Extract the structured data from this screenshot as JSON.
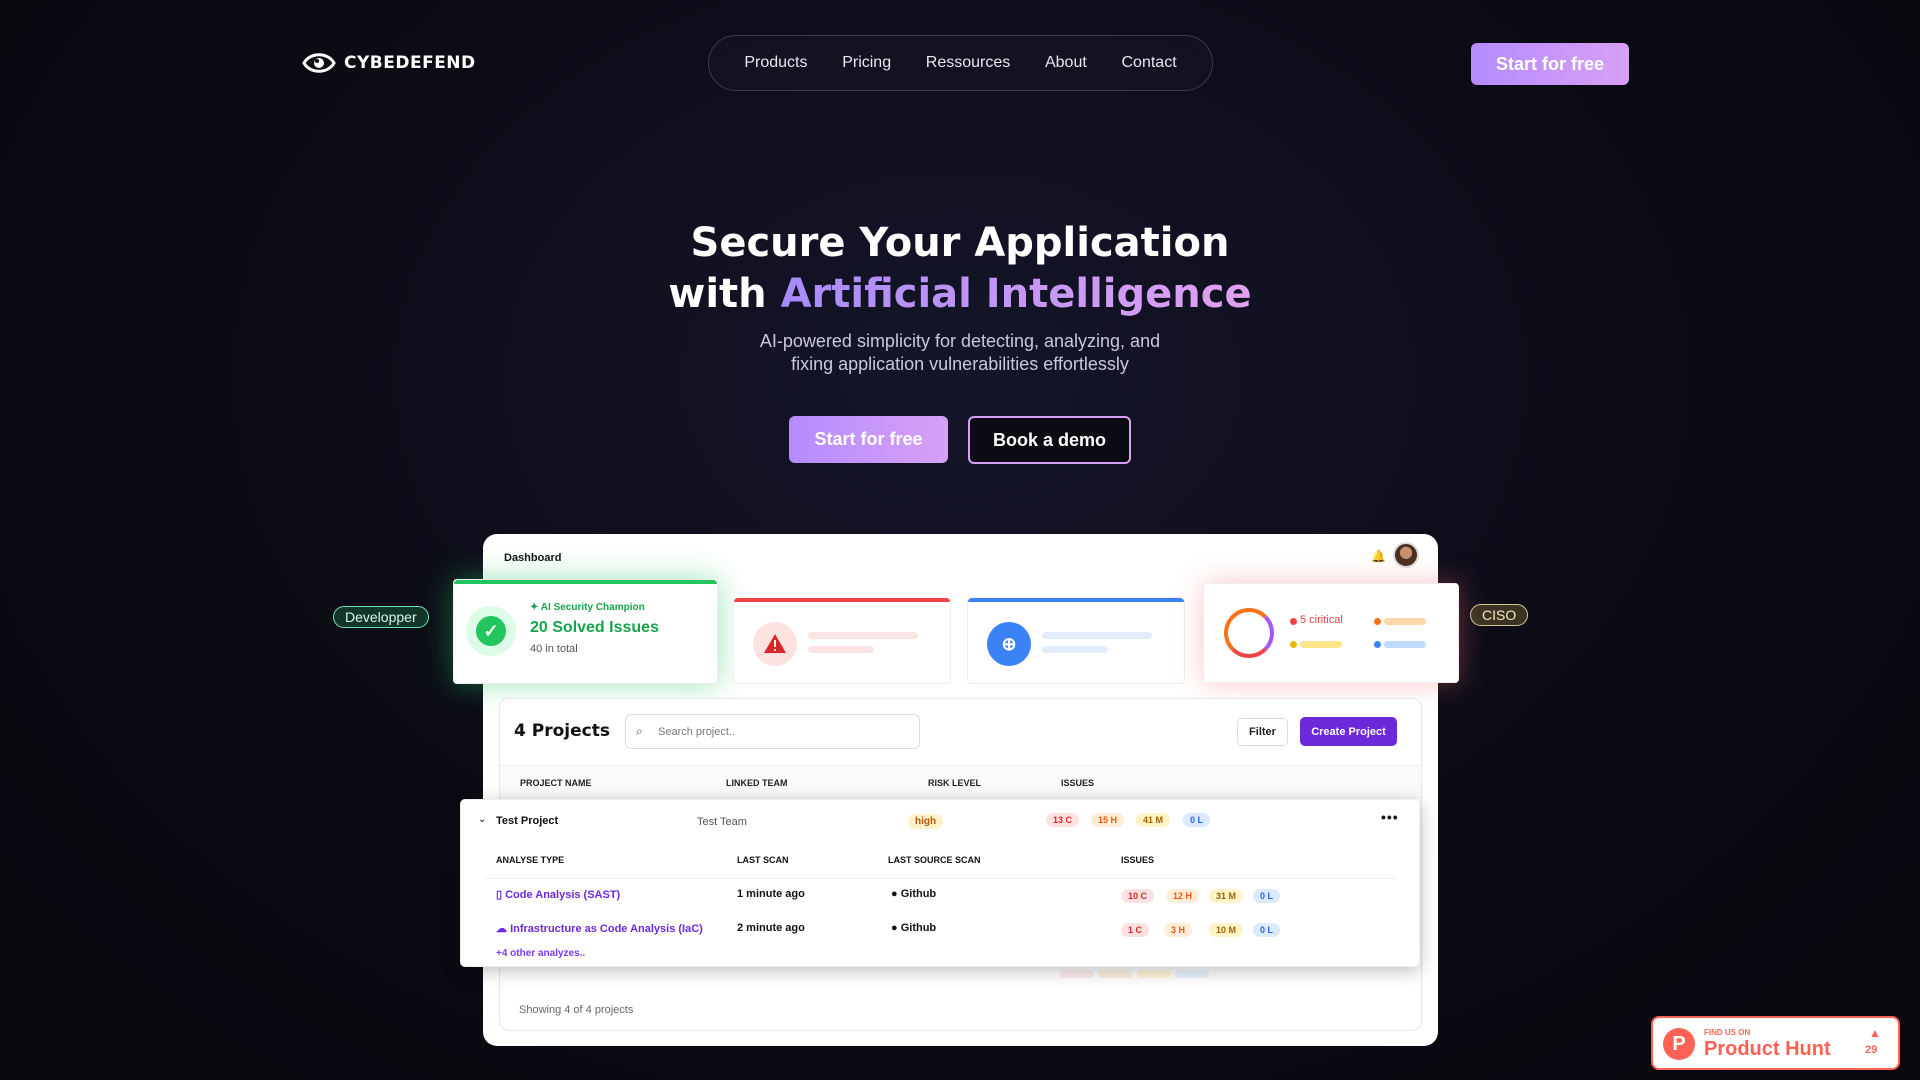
{
  "brand": {
    "name": "CYBEDEFEND"
  },
  "nav": {
    "items": [
      {
        "label": "Products"
      },
      {
        "label": "Pricing"
      },
      {
        "label": "Ressources"
      },
      {
        "label": "About"
      },
      {
        "label": "Contact"
      }
    ],
    "cta": "Start for free"
  },
  "hero": {
    "title_line1": "Secure Your Application",
    "title_line2_prefix": "with ",
    "title_line2_accent": "Artificial Intelligence",
    "subtitle_line1": "AI-powered simplicity for detecting, analyzing, and",
    "subtitle_line2": "fixing application vulnerabilities effortlessly",
    "cta_primary": "Start for free",
    "cta_secondary": "Book a demo"
  },
  "roles": {
    "dev": "Developper",
    "ciso": "CISO"
  },
  "dashboard": {
    "title": "Dashboard",
    "champion": {
      "tag": "AI Security Champion",
      "main": "20 Solved Issues",
      "sub": "40 in total"
    },
    "ciso_card": {
      "critical": "5 ciritical"
    },
    "projects": {
      "count_label": "4 Projects",
      "search_placeholder": "Search project..",
      "filter": "Filter",
      "create": "Create Project",
      "headers": [
        "PROJECT NAME",
        "LINKED TEAM",
        "RISK LEVEL",
        "ISSUES"
      ],
      "footer": "Showing 4 of 4 projects",
      "expanded": {
        "name": "Test Project",
        "team": "Test Team",
        "risk": "high",
        "issues": [
          "13 C",
          "15 H",
          "41 M",
          "0 L"
        ],
        "sub_headers": [
          "ANALYSE TYPE",
          "LAST SCAN",
          "LAST SOURCE SCAN",
          "ISSUES"
        ],
        "analyses": [
          {
            "name": "Code Analysis (SAST)",
            "last_scan": "1 minute ago",
            "source": "Github",
            "issues": [
              "10 C",
              "12 H",
              "31 M",
              "0 L"
            ]
          },
          {
            "name": "Infrastructure as Code Analysis (IaC)",
            "last_scan": "2 minute ago",
            "source": "Github",
            "issues": [
              "1 C",
              "3 H",
              "10 M",
              "0 L"
            ]
          }
        ],
        "more": "+4 other analyzes.."
      }
    }
  },
  "product_hunt": {
    "small": "FIND US ON",
    "big": "Product Hunt",
    "count": "29"
  },
  "colors": {
    "accent": "#b48cff",
    "critical": "#ef4444",
    "high": "#f97316",
    "medium": "#eab308",
    "low": "#3b82f6"
  }
}
